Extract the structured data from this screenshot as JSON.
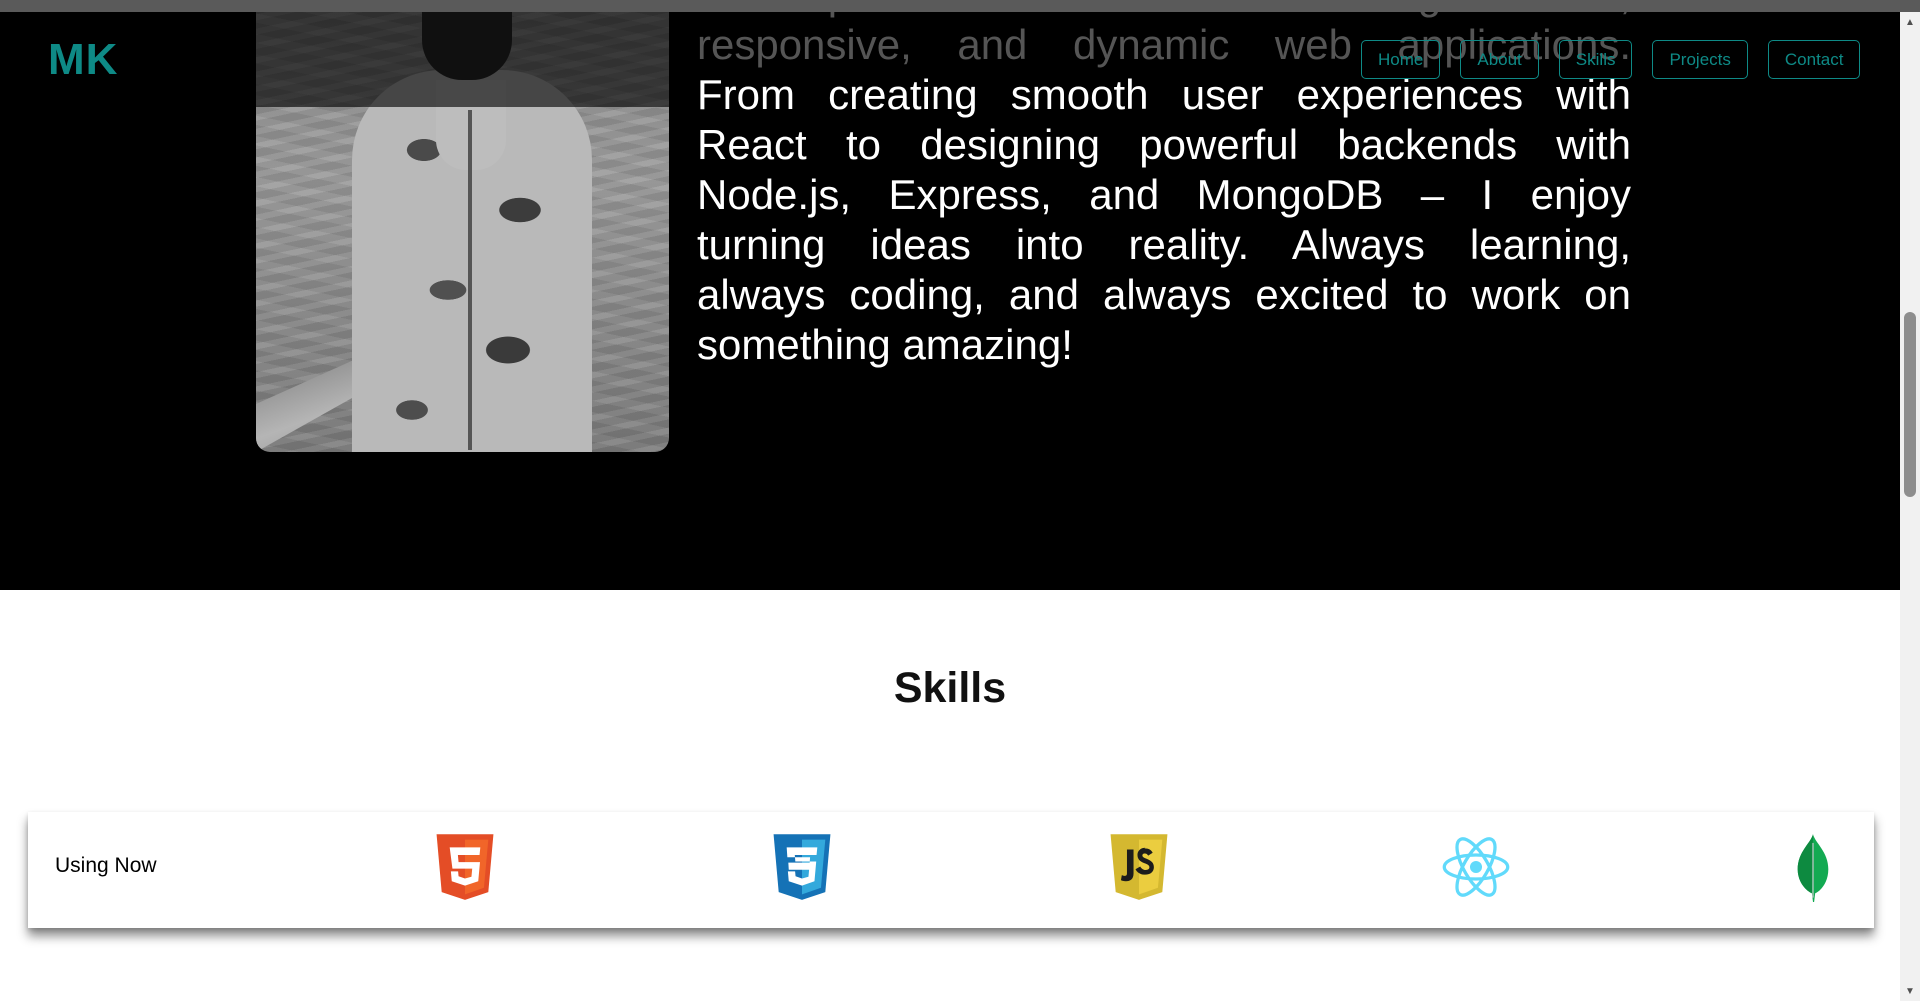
{
  "navbar": {
    "logo": "MK",
    "links": [
      {
        "label": "Home"
      },
      {
        "label": "About"
      },
      {
        "label": "Skills"
      },
      {
        "label": "Projects"
      },
      {
        "label": "Contact"
      }
    ],
    "accent_color": "#0e8a86"
  },
  "about": {
    "bio_lines": [
      "Developer who loves building clean,",
      "responsive, and dynamic web applications.",
      "From creating smooth user experiences with",
      "React to designing powerful backends with",
      "Node.js, Express, and MongoDB – I enjoy",
      "turning ideas into reality. Always learning,",
      "always coding, and always excited to work on",
      "something amazing!"
    ]
  },
  "skills": {
    "title": "Skills",
    "using_now_label": "Using Now",
    "icons": [
      "html5-icon",
      "css3-icon",
      "javascript-icon",
      "react-icon",
      "mongodb-icon"
    ]
  },
  "colors": {
    "html5": "#e44d26",
    "css3": "#1572b6",
    "javascript": "#d4b830",
    "react": "#61dafb",
    "mongodb": "#13aa52"
  }
}
